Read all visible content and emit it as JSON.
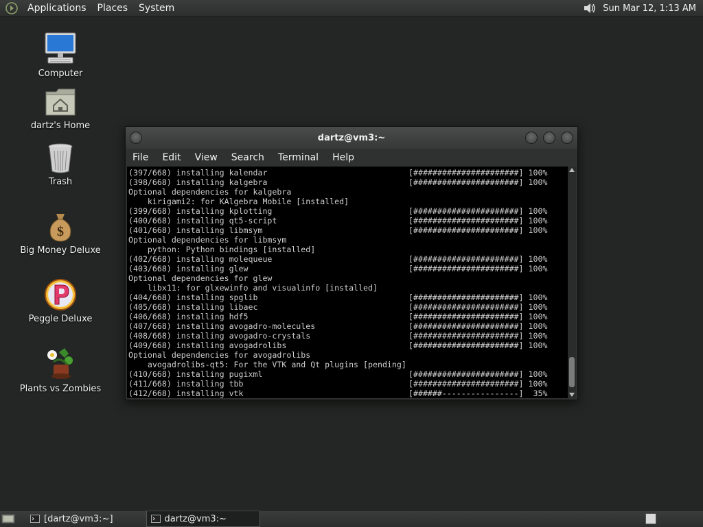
{
  "top_panel": {
    "menus": [
      "Applications",
      "Places",
      "System"
    ],
    "clock": "Sun Mar 12,  1:13 AM",
    "icons": {
      "menu": "gnome-foot-icon",
      "volume": "speaker-icon"
    }
  },
  "desktop_icons": [
    {
      "label": "Computer",
      "icon": "computer-icon"
    },
    {
      "label": "dartz's Home",
      "icon": "home-folder-icon"
    },
    {
      "label": "Trash",
      "icon": "trash-icon"
    },
    {
      "label": "Big Money Deluxe",
      "icon": "money-bag-icon"
    },
    {
      "label": "Peggle Deluxe",
      "icon": "peggle-icon"
    },
    {
      "label": "Plants vs Zombies",
      "icon": "plants-icon"
    }
  ],
  "terminal": {
    "title": "dartz@vm3:~",
    "menu": [
      "File",
      "Edit",
      "View",
      "Search",
      "Terminal",
      "Help"
    ],
    "lines": [
      {
        "left": "(397/668) installing kalendar",
        "right": "[######################] 100%"
      },
      {
        "left": "(398/668) installing kalgebra",
        "right": "[######################] 100%"
      },
      {
        "left": "Optional dependencies for kalgebra",
        "right": ""
      },
      {
        "left": "    kirigami2: for KAlgebra Mobile [installed]",
        "right": ""
      },
      {
        "left": "(399/668) installing kplotting",
        "right": "[######################] 100%"
      },
      {
        "left": "(400/668) installing qt5-script",
        "right": "[######################] 100%"
      },
      {
        "left": "(401/668) installing libmsym",
        "right": "[######################] 100%"
      },
      {
        "left": "Optional dependencies for libmsym",
        "right": ""
      },
      {
        "left": "    python: Python bindings [installed]",
        "right": ""
      },
      {
        "left": "(402/668) installing molequeue",
        "right": "[######################] 100%"
      },
      {
        "left": "(403/668) installing glew",
        "right": "[######################] 100%"
      },
      {
        "left": "Optional dependencies for glew",
        "right": ""
      },
      {
        "left": "    libx11: for glxewinfo and visualinfo [installed]",
        "right": ""
      },
      {
        "left": "(404/668) installing spglib",
        "right": "[######################] 100%"
      },
      {
        "left": "(405/668) installing libaec",
        "right": "[######################] 100%"
      },
      {
        "left": "(406/668) installing hdf5",
        "right": "[######################] 100%"
      },
      {
        "left": "(407/668) installing avogadro-molecules",
        "right": "[######################] 100%"
      },
      {
        "left": "(408/668) installing avogadro-crystals",
        "right": "[######################] 100%"
      },
      {
        "left": "(409/668) installing avogadrolibs",
        "right": "[######################] 100%"
      },
      {
        "left": "Optional dependencies for avogadrolibs",
        "right": ""
      },
      {
        "left": "    avogadrolibs-qt5: For the VTK and Qt plugins [pending]",
        "right": ""
      },
      {
        "left": "(410/668) installing pugixml",
        "right": "[######################] 100%"
      },
      {
        "left": "(411/668) installing tbb",
        "right": "[######################] 100%"
      },
      {
        "left": "(412/668) installing vtk",
        "right": "[######----------------]  35%"
      }
    ]
  },
  "bottom_panel": {
    "tasks": [
      {
        "label": "[dartz@vm3:~]",
        "active": false
      },
      {
        "label": "dartz@vm3:~",
        "active": true
      }
    ],
    "icons": {
      "show_desktop": "show-desktop-icon",
      "workspace": "workspace-switcher-icon"
    }
  }
}
